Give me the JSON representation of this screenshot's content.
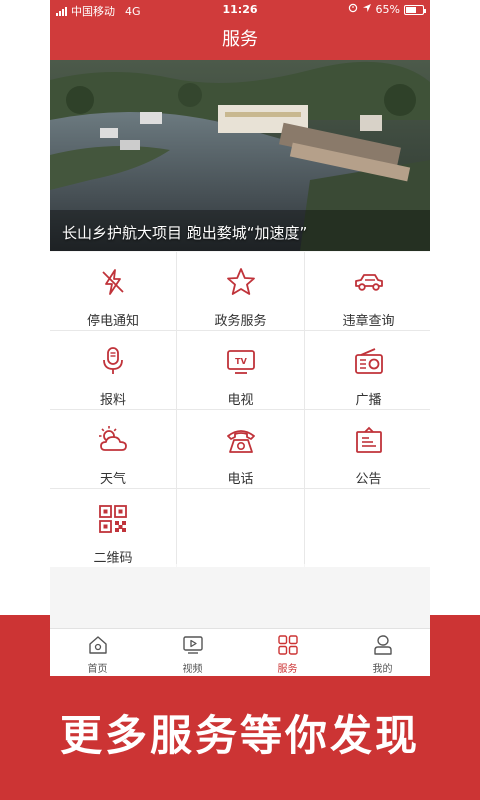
{
  "status_bar": {
    "carrier": "中国移动",
    "network": "4G",
    "time": "11:26",
    "battery": "65%",
    "battery_level": 0.65
  },
  "header": {
    "title": "服务"
  },
  "banner": {
    "caption": "长山乡护航大项目 跑出婺城“加速度”"
  },
  "services": [
    {
      "label": "停电通知",
      "icon": "power-outage-icon"
    },
    {
      "label": "政务服务",
      "icon": "star-icon"
    },
    {
      "label": "违章查询",
      "icon": "car-icon"
    },
    {
      "label": "报料",
      "icon": "microphone-icon"
    },
    {
      "label": "电视",
      "icon": "tv-icon"
    },
    {
      "label": "广播",
      "icon": "radio-icon"
    },
    {
      "label": "天气",
      "icon": "weather-icon"
    },
    {
      "label": "电话",
      "icon": "telephone-icon"
    },
    {
      "label": "公告",
      "icon": "notice-icon"
    },
    {
      "label": "二维码",
      "icon": "qr-code-icon"
    }
  ],
  "tabs": [
    {
      "label": "首页",
      "icon": "home-icon"
    },
    {
      "label": "视频",
      "icon": "video-icon"
    },
    {
      "label": "服务",
      "icon": "grid-icon",
      "active": true
    },
    {
      "label": "我的",
      "icon": "profile-icon"
    }
  ],
  "promo": {
    "slogan": "更多服务等你发现"
  },
  "colors": {
    "accent": "#cc3434",
    "icon": "#c0333a"
  }
}
